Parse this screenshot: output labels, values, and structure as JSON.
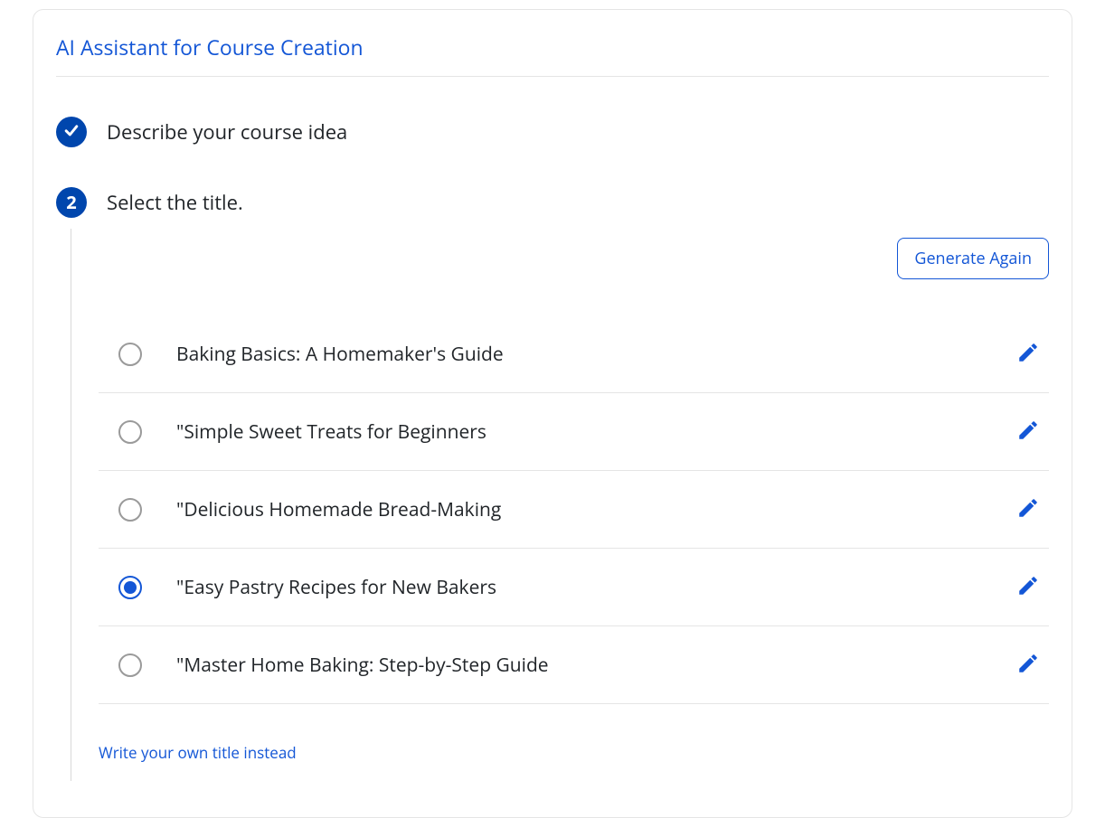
{
  "header": {
    "title": "AI Assistant for Course Creation"
  },
  "steps": {
    "s1": {
      "title": "Describe your course idea",
      "status": "complete"
    },
    "s2": {
      "number": "2",
      "title": "Select the title.",
      "generate_again_label": "Generate Again",
      "options": [
        {
          "label": "Baking Basics: A Homemaker's Guide",
          "selected": false
        },
        {
          "label": "\"Simple Sweet Treats for Beginners",
          "selected": false
        },
        {
          "label": "\"Delicious Homemade Bread-Making",
          "selected": false
        },
        {
          "label": "\"Easy Pastry Recipes for New Bakers",
          "selected": true
        },
        {
          "label": "\"Master Home Baking: Step-by-Step Guide",
          "selected": false
        }
      ],
      "write_own_label": "Write your own title instead"
    }
  }
}
